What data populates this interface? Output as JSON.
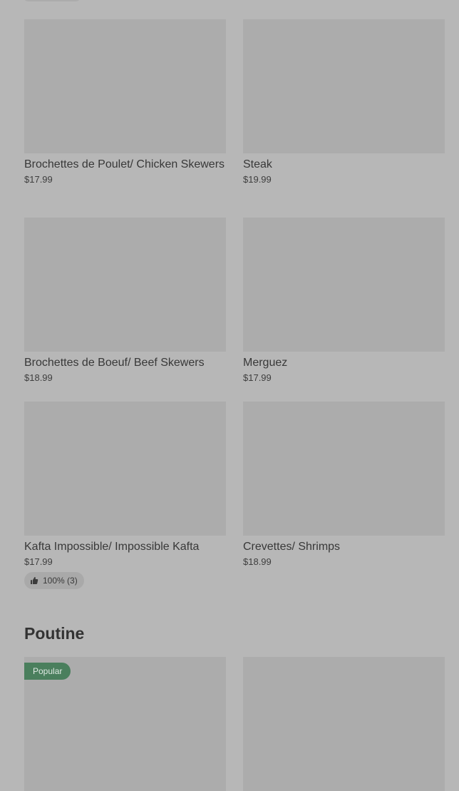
{
  "cards": [
    {
      "name": "Brochettes de Poulet/ Chicken Skewers",
      "price": "$17.99"
    },
    {
      "name": "Steak",
      "price": "$19.99"
    },
    {
      "name": "Brochettes de Boeuf/ Beef Skewers",
      "price": "$18.99"
    },
    {
      "name": "Merguez",
      "price": "$17.99"
    },
    {
      "name": "Kafta Impossible/ Impossible Kafta",
      "price": "$17.99",
      "rating": "100% (3)",
      "rating_icon": "thumbs-up-icon"
    },
    {
      "name": " Crevettes/ Shrimps",
      "price": "$18.99"
    }
  ],
  "poutine_section": {
    "title": "Poutine",
    "cards": [
      {
        "badge": "Popular",
        "badge_color": "#4a7f5d"
      },
      {}
    ]
  },
  "colors": {
    "background": "#b7b7b7",
    "image_placeholder": "#acacac",
    "popular_badge": "#4a7f5d"
  }
}
